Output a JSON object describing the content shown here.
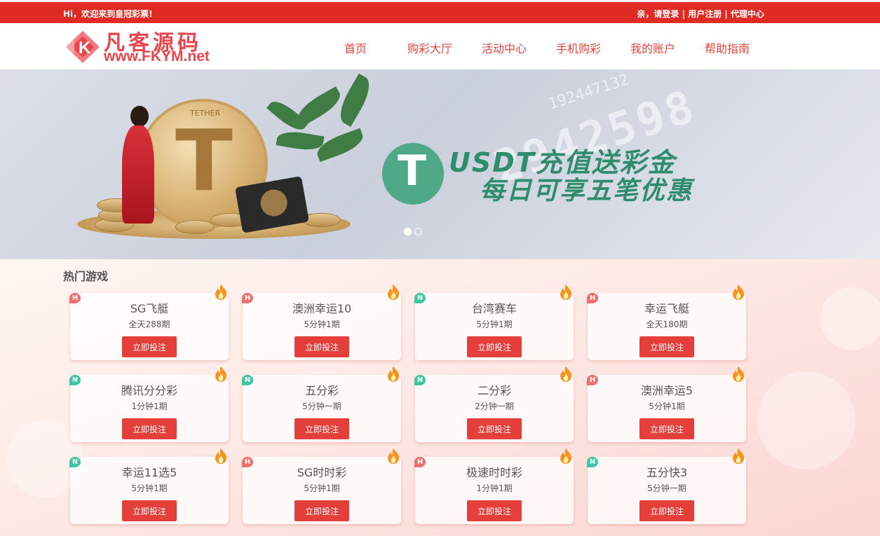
{
  "topbar": {
    "welcome": "Hi，欢迎来到皇冠彩票!",
    "greet": "亲，",
    "login": "请登录",
    "sep1": "|",
    "register": "用户注册",
    "sep2": "|",
    "agent": "代理中心"
  },
  "logo": {
    "brand_cn": "凡客源码",
    "brand_url": "www.FKYM.net",
    "mark_letter": "K"
  },
  "nav": {
    "items": [
      "首页",
      "购彩大厅",
      "活动中心",
      "手机购彩",
      "我的账户",
      "帮助指南"
    ]
  },
  "banner": {
    "coin_text": "TETHER",
    "headline_1": "USDT充值送彩金",
    "headline_2": "每日可享五笔优惠",
    "digits_big": "2942598",
    "digits_small": "192447132",
    "slide_count": 2,
    "active_slide": 1
  },
  "games": {
    "title": "热门游戏",
    "bet_label": "立即投注",
    "items": [
      {
        "tag": "H",
        "name": "SG飞艇",
        "period": "全天288期"
      },
      {
        "tag": "H",
        "name": "澳洲幸运10",
        "period": "5分钟1期"
      },
      {
        "tag": "N",
        "name": "台湾赛车",
        "period": "5分钟1期"
      },
      {
        "tag": "H",
        "name": "幸运飞艇",
        "period": "全天180期"
      },
      {
        "tag": "N",
        "name": "腾讯分分彩",
        "period": "1分钟1期"
      },
      {
        "tag": "N",
        "name": "五分彩",
        "period": "5分钟一期"
      },
      {
        "tag": "N",
        "name": "二分彩",
        "period": "2分钟一期"
      },
      {
        "tag": "H",
        "name": "澳洲幸运5",
        "period": "5分钟1期"
      },
      {
        "tag": "N",
        "name": "幸运11选5",
        "period": "5分钟1期"
      },
      {
        "tag": "H",
        "name": "SG时时彩",
        "period": "5分钟1期"
      },
      {
        "tag": "H",
        "name": "极速时时彩",
        "period": "1分钟1期"
      },
      {
        "tag": "N",
        "name": "五分快3",
        "period": "5分钟一期"
      }
    ]
  },
  "colors": {
    "brand_red": "#e02b24",
    "button_red": "#e43f3b",
    "tag_hot": "#ee6f6f",
    "tag_new": "#3cc7a2",
    "banner_green": "#2f8d6d"
  }
}
